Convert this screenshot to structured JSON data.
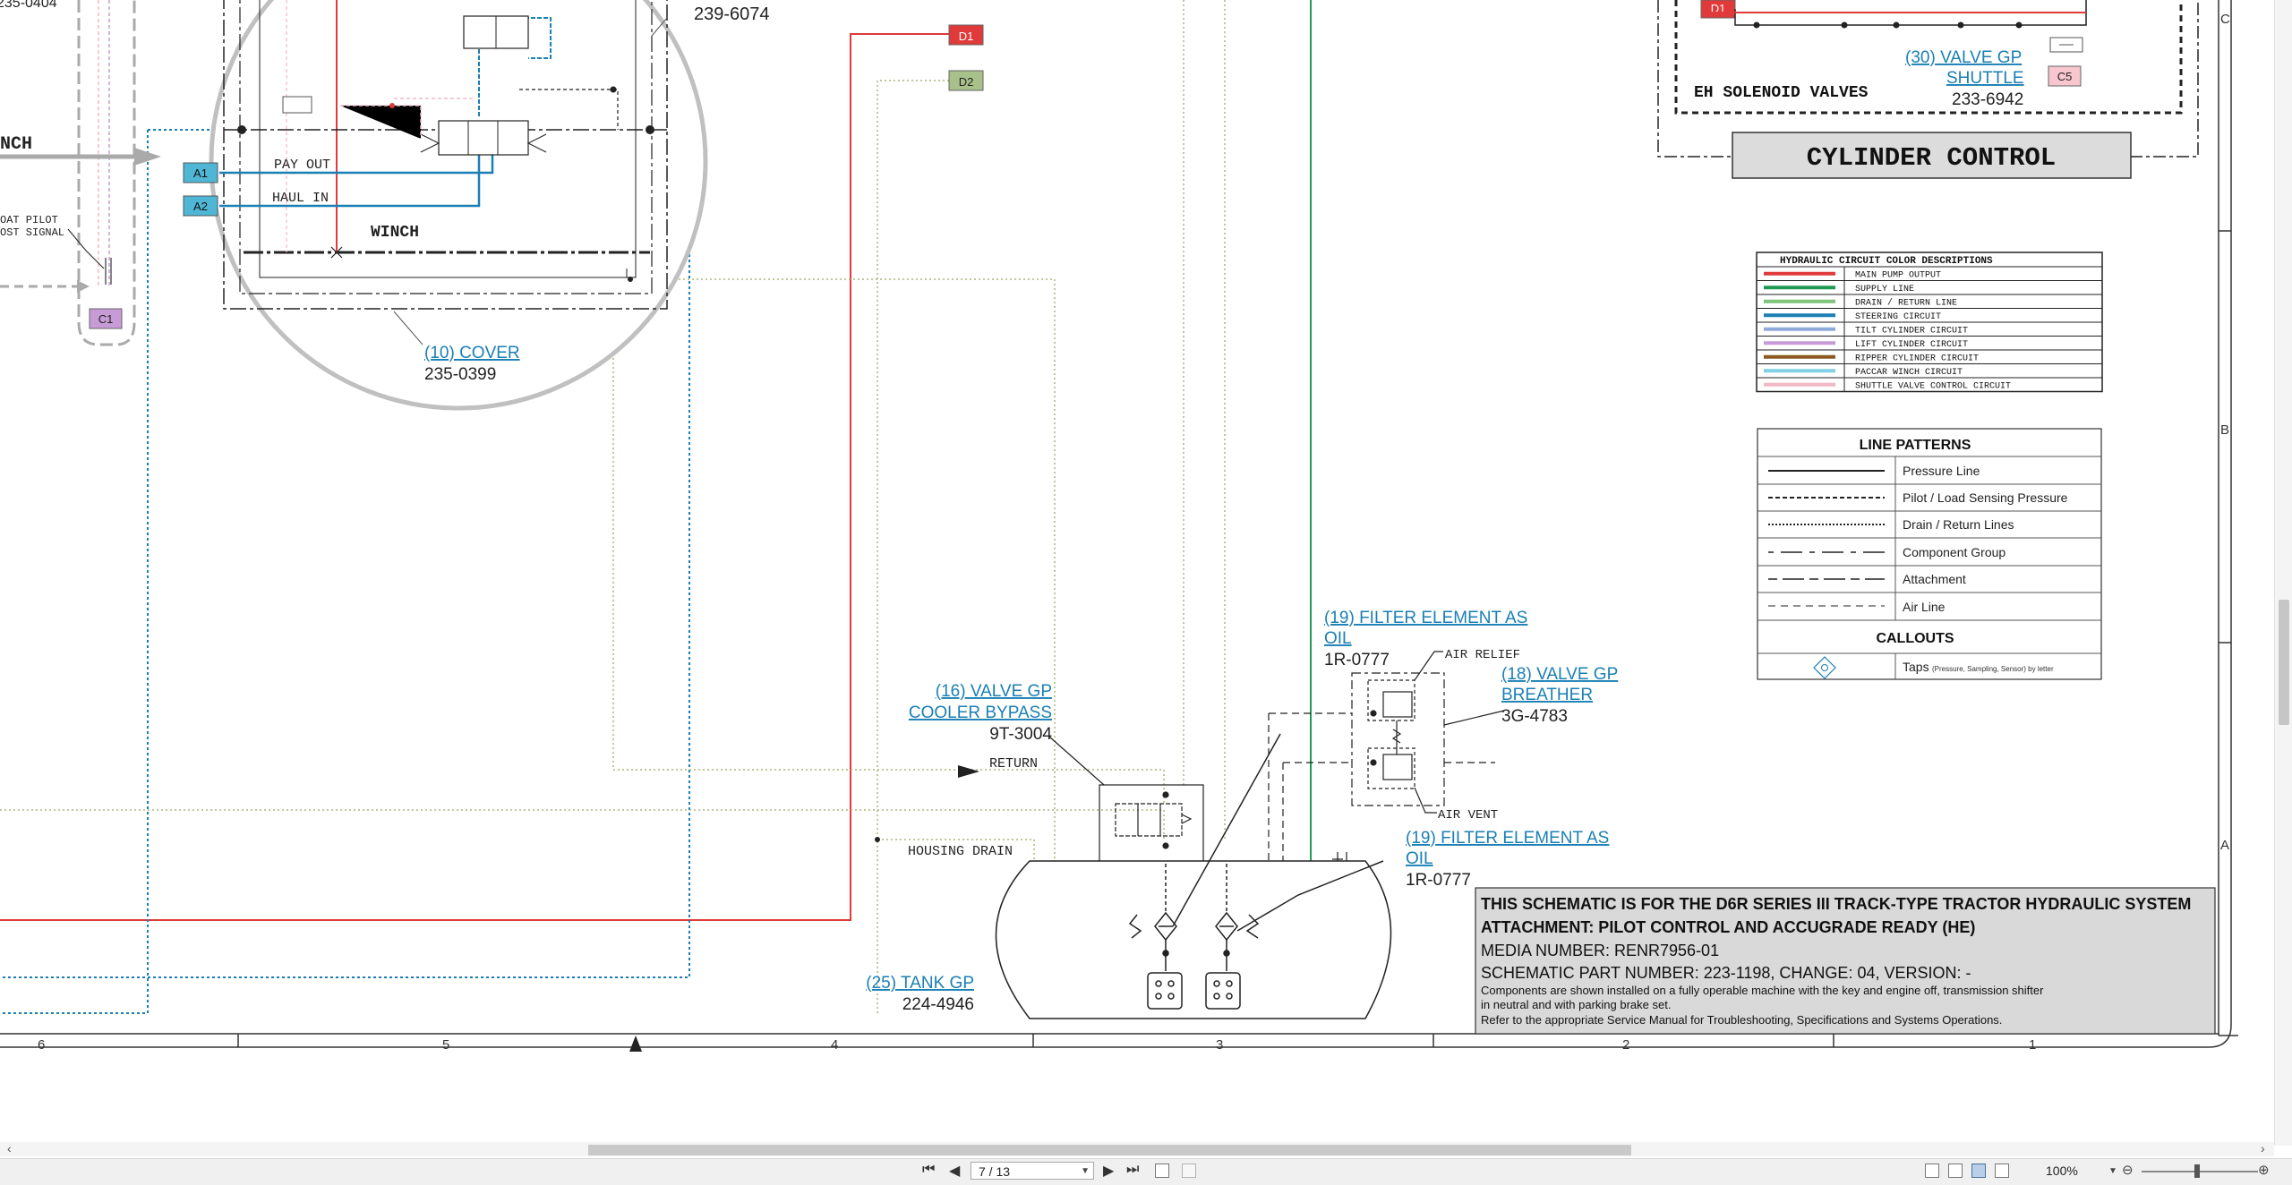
{
  "drawing": {
    "cut_text_top_left": "235-0404",
    "winch_cut": "NCH",
    "float_pilot": [
      "OAT PILOT",
      "OST SIGNAL"
    ],
    "part_239": "239-6074",
    "pay_out": "PAY OUT",
    "haul_in": "HAUL IN",
    "winch": "WINCH",
    "cover": {
      "label": "(10) COVER",
      "part": "235-0399"
    },
    "tags": {
      "d1": "D1",
      "d2": "D2",
      "a1": "A1",
      "a2": "A2",
      "c1": "C1",
      "c5": "C5",
      "d1b": "D1"
    },
    "valve_shuttle": {
      "line1": "(30) VALVE GP",
      "line2": "SHUTTLE",
      "part": "233-6942"
    },
    "eh_solenoid": "EH SOLENOID VALVES",
    "cylinder_control": "CYLINDER CONTROL",
    "filter_top": {
      "line1": "(19) FILTER ELEMENT AS",
      "line2": "OIL",
      "part": "1R-0777"
    },
    "air_relief": "AIR RELIEF",
    "breather": {
      "line1": "(18) VALVE GP",
      "line2": "BREATHER",
      "part": "3G-4783"
    },
    "air_vent": "AIR VENT",
    "filter_bottom": {
      "line1": "(19) FILTER ELEMENT AS",
      "line2": "OIL",
      "part": "1R-0777"
    },
    "cooler": {
      "line1": "(16) VALVE GP",
      "line2": "COOLER BYPASS",
      "part": "9T-3004"
    },
    "return": "RETURN",
    "housing_drain": "HOUSING DRAIN",
    "tank": {
      "label": "(25) TANK GP",
      "part": "224-4946"
    },
    "row_markers": [
      "C",
      "B",
      "A"
    ],
    "col_markers": [
      "6",
      "5",
      "4",
      "3",
      "2",
      "1"
    ]
  },
  "color_legend": {
    "title": "HYDRAULIC CIRCUIT COLOR DESCRIPTIONS",
    "items": [
      {
        "label": "MAIN PUMP OUTPUT",
        "color": "#e03a3a"
      },
      {
        "label": "SUPPLY LINE",
        "color": "#1f9a54"
      },
      {
        "label": "DRAIN / RETURN LINE",
        "color": "#7fc47a"
      },
      {
        "label": "STEERING CIRCUIT",
        "color": "#1a7fb4"
      },
      {
        "label": "TILT CYLINDER CIRCUIT",
        "color": "#8fa9d8"
      },
      {
        "label": "LIFT CYLINDER CIRCUIT",
        "color": "#c79bd6"
      },
      {
        "label": "RIPPER CYLINDER CIRCUIT",
        "color": "#8a5a1e"
      },
      {
        "label": "PACCAR WINCH CIRCUIT",
        "color": "#7fd0e3"
      },
      {
        "label": "SHUTTLE VALVE CONTROL CIRCUIT",
        "color": "#f2b8c6"
      }
    ]
  },
  "line_patterns": {
    "title": "LINE PATTERNS",
    "items": [
      "Pressure Line",
      "Pilot / Load Sensing Pressure",
      "Drain / Return Lines",
      "Component Group",
      "Attachment",
      "Air Line"
    ],
    "callouts_title": "CALLOUTS",
    "taps": "Taps",
    "taps_small": "(Pressure, Sampling, Sensor) by letter"
  },
  "title_block": {
    "line1": "THIS SCHEMATIC IS FOR THE D6R SERIES III TRACK-TYPE TRACTOR HYDRAULIC SYSTEM",
    "line2": "ATTACHMENT: PILOT CONTROL AND ACCUGRADE READY (HE)",
    "line3": "MEDIA NUMBER: RENR7956-01",
    "line4": "SCHEMATIC PART NUMBER: 223-1198, CHANGE: 04, VERSION: -",
    "line5": "Components are shown installed on a fully operable machine with the key and engine off, transmission shifter",
    "line6": "in neutral and with parking brake set.",
    "line7": "Refer to the appropriate Service Manual for Troubleshooting, Specifications and Systems Operations."
  },
  "statusbar": {
    "page": "7 / 13",
    "zoom": "100%"
  },
  "colors": {
    "main_pump": "#e03a3a",
    "supply": "#1f9a54",
    "drain": "#a9b57a",
    "steering": "#1a7fb4",
    "winch": "#7fd0e3",
    "shuttle": "#f2b8c6"
  }
}
